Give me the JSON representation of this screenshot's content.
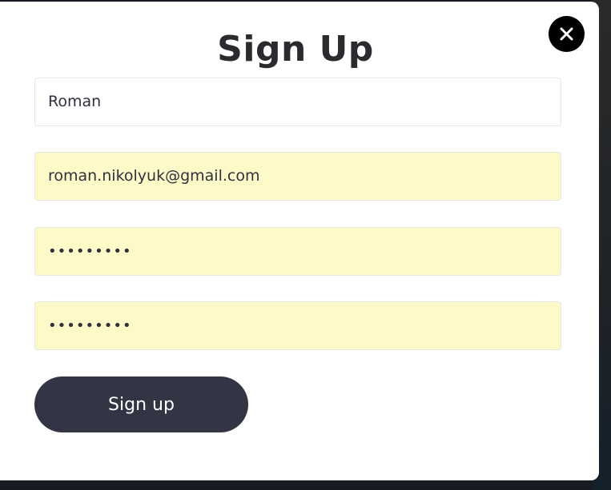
{
  "modal": {
    "title": "Sign Up",
    "close_icon": "close-icon",
    "fields": {
      "name": {
        "value": "Roman",
        "autofilled": false
      },
      "email": {
        "value": "roman.nikolyuk@gmail.com",
        "autofilled": true
      },
      "password": {
        "value": "•••••••••",
        "autofilled": true
      },
      "confirm_password": {
        "value": "•••••••••",
        "autofilled": true
      }
    },
    "submit_label": "Sign up"
  },
  "colors": {
    "autofill_bg": "#fefac7",
    "button_bg": "#333444",
    "backdrop": "#161c22"
  }
}
